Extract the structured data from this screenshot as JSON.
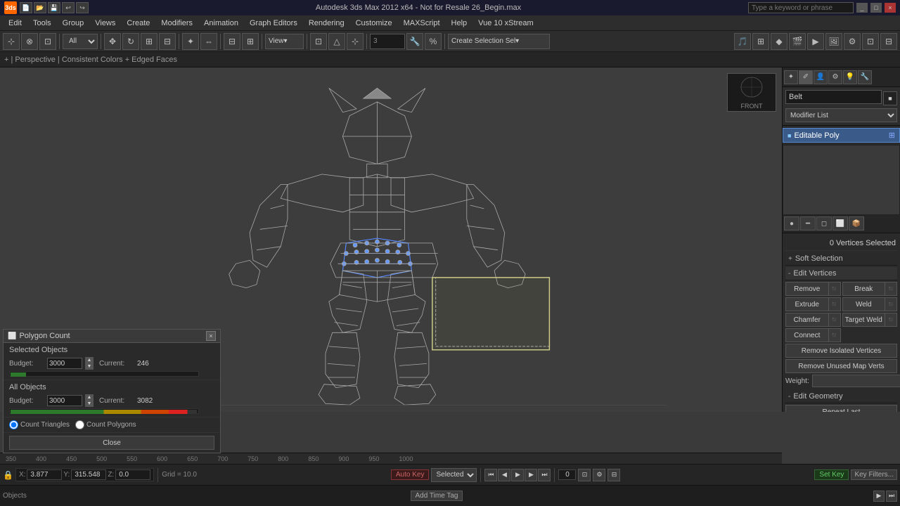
{
  "titlebar": {
    "title": "Autodesk 3ds Max 2012 x64 - Not for Resale    26_Begin.max",
    "search_placeholder": "Type a keyword or phrase"
  },
  "menubar": {
    "items": [
      "Edit",
      "Tools",
      "Group",
      "Views",
      "Create",
      "Modifiers",
      "Animation",
      "Graph Editors",
      "Rendering",
      "Customize",
      "MAXScript",
      "Help",
      "Vue 10 xStream"
    ]
  },
  "toolbar": {
    "view_label": "View",
    "create_selection_label": "Create Selection Sel",
    "filter_label": "All"
  },
  "viewport": {
    "info": "+ | Perspective | Consistent Colors + Edged Faces",
    "front_label": "FRONT"
  },
  "right_panel": {
    "modifier_name": "Belt",
    "modifier_list_label": "Modifier List",
    "editable_poly_label": "Editable Poly",
    "icons": [
      "☀",
      "◆",
      "👤",
      "⚙",
      "💡",
      "✏"
    ],
    "sub_icons": [
      "◀",
      "▶",
      "⬜",
      "📋",
      "📷"
    ],
    "sel_count": "0 Vertices Selected",
    "soft_selection_label": "Soft Selection",
    "plus_sign": "+",
    "minus_sign": "-",
    "edit_vertices_label": "Edit Vertices",
    "remove_label": "Remove",
    "break_label": "Break",
    "extrude_label": "Extrude",
    "weld_label": "Weld",
    "chamfer_label": "Chamfer",
    "target_weld_label": "Target Weld",
    "connect_label": "Connect",
    "remove_isolated_label": "Remove Isolated Vertices",
    "remove_unused_label": "Remove Unused Map Verts",
    "weight_label": "Weight:",
    "edit_geometry_label": "Edit Geometry",
    "repeat_last_label": "Repeat Last"
  },
  "poly_count": {
    "title": "Polygon Count",
    "selected_objects": "Selected Objects",
    "budget_label": "Budget:",
    "budget_value": "3000",
    "current_label": "Current:",
    "selected_current": "246",
    "all_objects": "All Objects",
    "all_budget_value": "3000",
    "all_current": "3082",
    "count_triangles": "Count Triangles",
    "count_polygons": "Count Polygons",
    "close_label": "Close"
  },
  "bottom": {
    "x_label": "X:",
    "x_val": "3.877",
    "y_label": "Y:",
    "y_val": "315.548",
    "z_label": "Z:",
    "z_val": "0.0",
    "grid_label": "Grid = 10.0",
    "auto_key_label": "Auto Key",
    "selected_label": "Selected",
    "set_key_label": "Set Key",
    "key_filters_label": "Key Filters...",
    "frame_count": "0",
    "add_time_tag": "Add Time Tag",
    "timeline_nums": [
      "350",
      "400",
      "450",
      "500",
      "550",
      "600",
      "650",
      "700",
      "750",
      "800",
      "850",
      "900",
      "950",
      "1000"
    ]
  },
  "icons": {
    "lock": "🔒",
    "play": "▶",
    "pause": "⏸",
    "next": "⏭",
    "prev": "⏮",
    "first": "⏮",
    "last": "⏭"
  }
}
